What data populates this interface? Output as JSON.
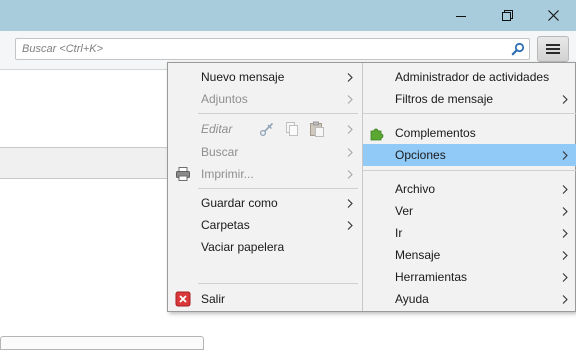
{
  "window": {
    "controls": [
      "minimize-icon",
      "restore-icon",
      "close-icon"
    ]
  },
  "toolbar": {
    "search_placeholder": "Buscar <Ctrl+K>",
    "search_icon": "magnifier-icon",
    "menu_icon": "hamburger-menu-icon"
  },
  "menu": {
    "left": [
      {
        "label": "Nuevo mensaje",
        "submenu": true,
        "disabled": false
      },
      {
        "label": "Adjuntos",
        "submenu": true,
        "disabled": true
      },
      {
        "label": "Editar",
        "submenu": true,
        "disabled": true,
        "icons": [
          "cut-icon",
          "copy-icon",
          "paste-icon"
        ]
      },
      {
        "label": "Buscar",
        "submenu": true,
        "disabled": true
      },
      {
        "label": "Imprimir...",
        "submenu": true,
        "disabled": true,
        "icon": "printer-icon"
      },
      {
        "label": "Guardar como",
        "submenu": true,
        "disabled": false
      },
      {
        "label": "Carpetas",
        "submenu": true,
        "disabled": false
      },
      {
        "label": "Vaciar papelera",
        "submenu": false,
        "disabled": false
      },
      {
        "label": "Salir",
        "submenu": false,
        "disabled": false,
        "icon": "exit-icon"
      }
    ],
    "right": [
      {
        "label": "Administrador de actividades",
        "submenu": false
      },
      {
        "label": "Filtros de mensaje",
        "submenu": true
      },
      {
        "label": "Complementos",
        "submenu": false,
        "icon": "puzzle-piece-icon"
      },
      {
        "label": "Opciones",
        "submenu": true,
        "highlighted": true
      },
      {
        "label": "Archivo",
        "submenu": true
      },
      {
        "label": "Ver",
        "submenu": true
      },
      {
        "label": "Ir",
        "submenu": true
      },
      {
        "label": "Mensaje",
        "submenu": true
      },
      {
        "label": "Herramientas",
        "submenu": true
      },
      {
        "label": "Ayuda",
        "submenu": true
      }
    ]
  },
  "colors": {
    "titlebar": "#a8ccdc",
    "highlight": "#91c9f7",
    "exit_icon": "#d9373a",
    "puzzle_icon": "#5aa832"
  }
}
